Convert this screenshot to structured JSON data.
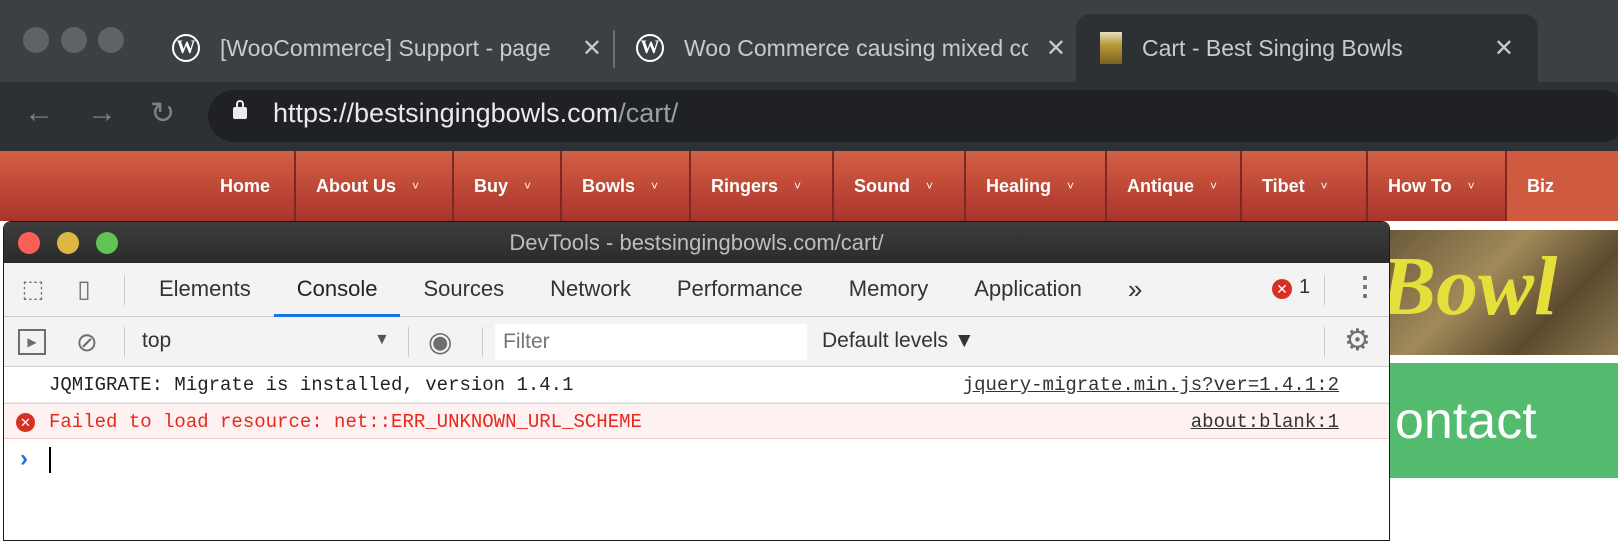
{
  "browser": {
    "tabs": [
      {
        "title": "[WooCommerce] Support - page",
        "icon": "wordpress-icon",
        "active": false
      },
      {
        "title": "Woo Commerce causing mixed content",
        "icon": "wordpress-icon",
        "active": false
      },
      {
        "title": "Cart - Best Singing Bowls",
        "icon": "singing-bowl-favicon",
        "active": true
      }
    ],
    "close_glyph": "✕",
    "url_host": "https://bestsingingbowls.com",
    "url_path": "/cart/"
  },
  "site": {
    "nav": [
      "Home",
      "About Us",
      "Buy",
      "Bowls",
      "Ringers",
      "Sound",
      "Healing",
      "Antique",
      "Tibet",
      "How To",
      "Biz"
    ],
    "hero_text": "Bowl",
    "contact_text": "ontact",
    "accent": "#c9473a",
    "contact_color": "#52bb6e"
  },
  "devtools": {
    "title": "DevTools - bestsingingbowls.com/cart/",
    "tabs": [
      "Elements",
      "Console",
      "Sources",
      "Network",
      "Performance",
      "Memory",
      "Application"
    ],
    "active_tab": "Console",
    "more": "»",
    "error_count": "1",
    "context": "top",
    "filter_placeholder": "Filter",
    "levels": "Default levels ▼",
    "messages": [
      {
        "text": "JQMIGRATE: Migrate is installed, version 1.4.1",
        "source": "jquery-migrate.min.js?ver=1.4.1:2",
        "level": "info"
      },
      {
        "text": "Failed to load resource: net::ERR_UNKNOWN_URL_SCHEME",
        "source": "about:blank:1",
        "level": "error"
      }
    ],
    "prompt": "›"
  }
}
